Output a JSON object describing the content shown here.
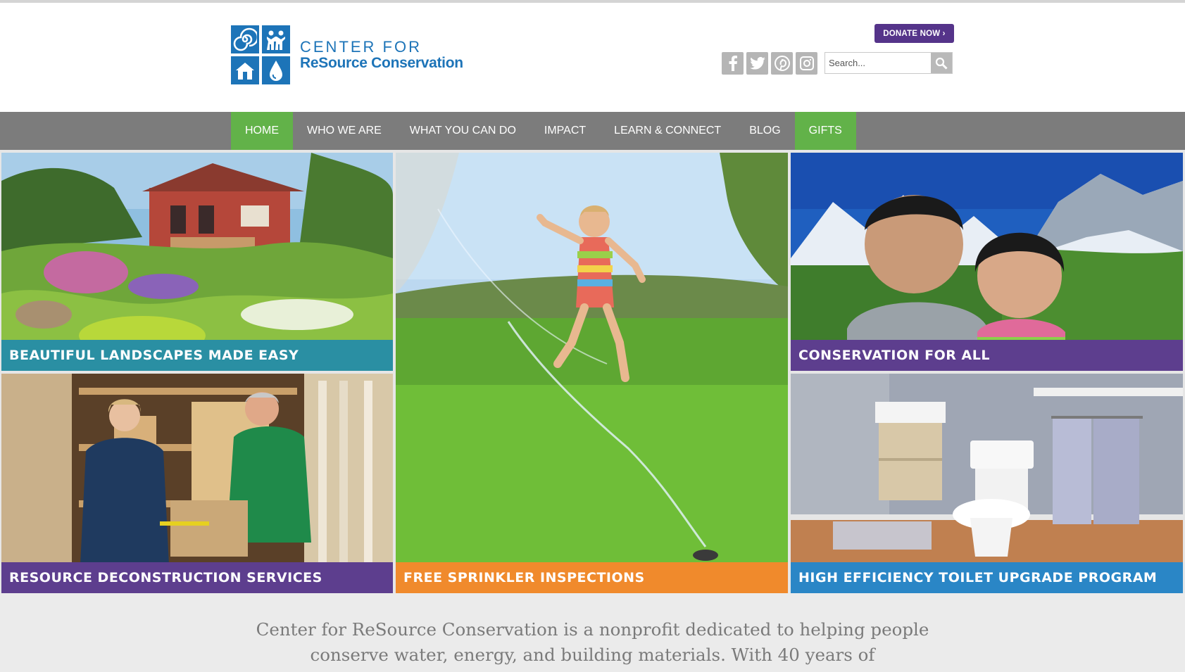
{
  "brand": {
    "line1": "CENTER FOR",
    "line2": "ReSource Conservation"
  },
  "header": {
    "donate_label": "DONATE NOW ›",
    "socials": [
      {
        "icon": "facebook-icon"
      },
      {
        "icon": "twitter-icon"
      },
      {
        "icon": "pinterest-icon"
      },
      {
        "icon": "instagram-icon"
      }
    ],
    "search": {
      "placeholder": "Search...",
      "value": ""
    }
  },
  "nav": {
    "items": [
      {
        "label": "HOME",
        "active": true
      },
      {
        "label": "WHO WE ARE",
        "active": false
      },
      {
        "label": "WHAT YOU CAN DO",
        "active": false
      },
      {
        "label": "IMPACT",
        "active": false
      },
      {
        "label": "LEARN & CONNECT",
        "active": false
      },
      {
        "label": "BLOG",
        "active": false
      },
      {
        "label": "GIFTS",
        "active": true
      }
    ]
  },
  "tiles": {
    "landscapes": {
      "label": "Beautiful Landscapes Made Easy",
      "color": "#2a8fa3"
    },
    "sprinkler": {
      "label": "Free Sprinkler Inspections",
      "color": "#f08a2c"
    },
    "conservation": {
      "label": "Conservation For All",
      "color": "#5d3e8e"
    },
    "deconstruction": {
      "label": "ReSource Deconstruction Services",
      "color": "#5d3e8e"
    },
    "toilet": {
      "label": "High Efficiency Toilet Upgrade Program",
      "color": "#2a86c6"
    }
  },
  "intro": {
    "line1": "Center for ReSource Conservation is a nonprofit dedicated to helping people",
    "line2": "conserve water, energy, and building materials. With 40 years of"
  },
  "colors": {
    "brand_blue": "#1d74b8",
    "nav_gray": "#7c7c7c",
    "nav_active_green": "#62b249",
    "donate_purple": "#55348a"
  }
}
